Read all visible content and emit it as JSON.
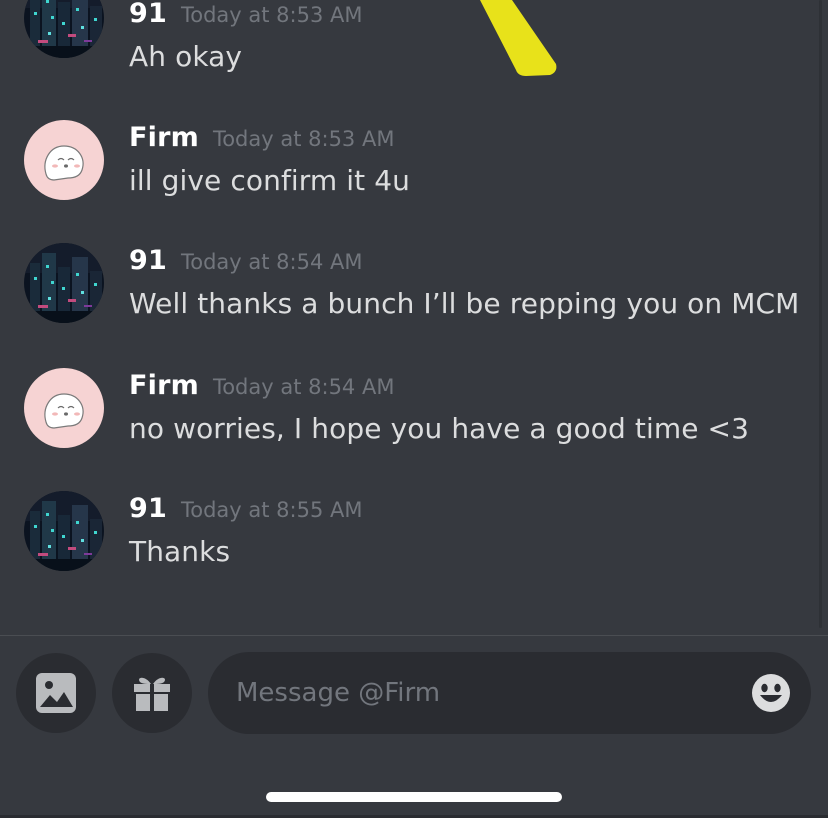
{
  "conversation": {
    "messages": [
      {
        "author": "91",
        "time": "Today at 8:53 AM",
        "text": "Ah okay"
      },
      {
        "author": "Firm",
        "time": "Today at 8:53 AM",
        "text": "ill give confirm it 4u"
      },
      {
        "author": "91",
        "time": "Today at 8:54 AM",
        "text": "Well thanks a bunch I’ll be repping you on MCM"
      },
      {
        "author": "Firm",
        "time": "Today at 8:54 AM",
        "text": "no worries, I hope you have a good time <3"
      },
      {
        "author": "91",
        "time": "Today at 8:55 AM",
        "text": "Thanks"
      }
    ]
  },
  "composer": {
    "placeholder": "Message @Firm",
    "icons": {
      "image": "image-icon",
      "gift": "gift-icon",
      "emoji": "emoji-icon"
    }
  },
  "avatars": {
    "91": "city-night-avatar",
    "Firm": "ghost-avatar"
  },
  "colors": {
    "background": "#36393f",
    "input_background": "#2a2c31",
    "username": "#ffffff",
    "timestamp": "#72767d",
    "message_text": "#dcddde",
    "highlight_mark": "#e8e21a"
  }
}
